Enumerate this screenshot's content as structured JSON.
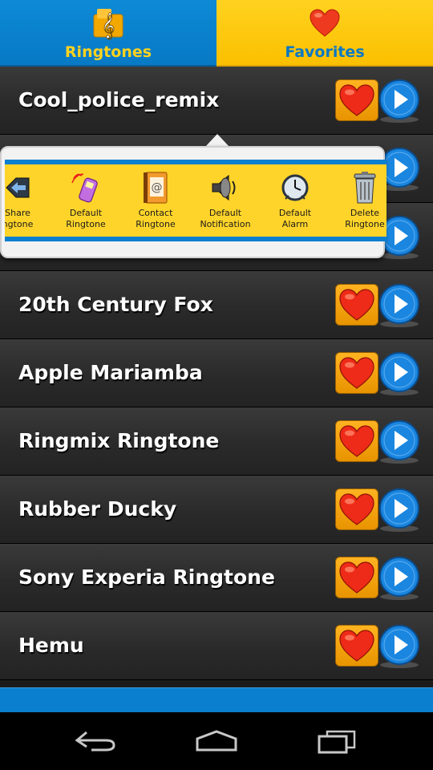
{
  "tabs": [
    {
      "label": "Ringtones",
      "icon": "music-note-icon",
      "active": true
    },
    {
      "label": "Favorites",
      "icon": "heart-icon",
      "active": false
    }
  ],
  "rows": [
    {
      "title": "Cool_police_remix"
    },
    {
      "title": ""
    },
    {
      "title": ""
    },
    {
      "title": "20th Century Fox"
    },
    {
      "title": "Apple Mariamba"
    },
    {
      "title": "Ringmix Ringtone"
    },
    {
      "title": "Rubber Ducky"
    },
    {
      "title": "Sony Experia Ringtone"
    },
    {
      "title": "Hemu"
    }
  ],
  "popup": {
    "actions": [
      {
        "label": "Share\nngtone",
        "icon": "share-icon"
      },
      {
        "label": "Default\nRingtone",
        "icon": "phone-icon"
      },
      {
        "label": "Contact\nRingtone",
        "icon": "contact-book-icon"
      },
      {
        "label": "Default\nNotification",
        "icon": "speaker-icon"
      },
      {
        "label": "Default\nAlarm",
        "icon": "clock-icon"
      },
      {
        "label": "Delete\nRingtone",
        "icon": "trash-icon"
      }
    ]
  },
  "navbar": {
    "back": "back-icon",
    "home": "home-icon",
    "recents": "recents-icon"
  },
  "colors": {
    "primary_blue": "#0a7fcf",
    "accent_yellow": "#ffd21f",
    "heart_red": "#e8201a"
  }
}
